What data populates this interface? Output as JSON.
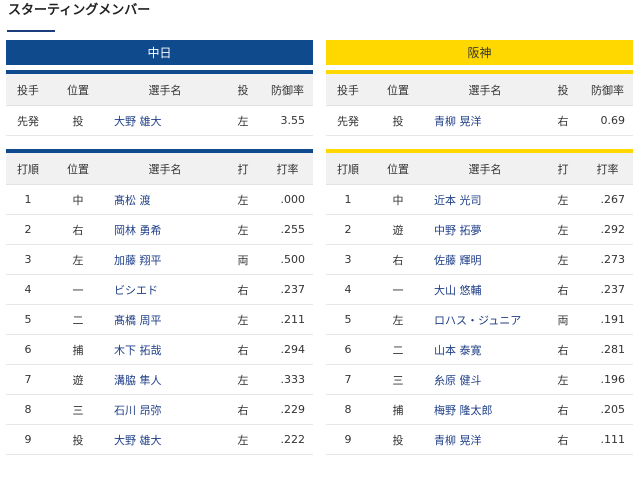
{
  "page_title": "スターティングメンバー",
  "colors": {
    "home_accent": "#0f4a8c",
    "away_accent": "#ffd800",
    "name_link": "#1f3f88",
    "header_bg": "#f1f1f1"
  },
  "teams": [
    {
      "name": "中日",
      "pitcher_headers": [
        "投手",
        "位置",
        "選手名",
        "投",
        "防御率"
      ],
      "pitcher": [
        "先発",
        "投",
        "大野 雄大",
        "左",
        "3.55"
      ],
      "batting_headers": [
        "打順",
        "位置",
        "選手名",
        "打",
        "打率"
      ],
      "batters": [
        [
          "1",
          "中",
          "髙松 渡",
          "左",
          ".000"
        ],
        [
          "2",
          "右",
          "岡林 勇希",
          "左",
          ".255"
        ],
        [
          "3",
          "左",
          "加藤 翔平",
          "両",
          ".500"
        ],
        [
          "4",
          "一",
          "ビシエド",
          "右",
          ".237"
        ],
        [
          "5",
          "二",
          "髙橋 周平",
          "左",
          ".211"
        ],
        [
          "6",
          "捕",
          "木下 拓哉",
          "右",
          ".294"
        ],
        [
          "7",
          "遊",
          "溝脇 隼人",
          "左",
          ".333"
        ],
        [
          "8",
          "三",
          "石川 昂弥",
          "右",
          ".229"
        ],
        [
          "9",
          "投",
          "大野 雄大",
          "左",
          ".222"
        ]
      ]
    },
    {
      "name": "阪神",
      "pitcher_headers": [
        "投手",
        "位置",
        "選手名",
        "投",
        "防御率"
      ],
      "pitcher": [
        "先発",
        "投",
        "青柳 晃洋",
        "右",
        "0.69"
      ],
      "batting_headers": [
        "打順",
        "位置",
        "選手名",
        "打",
        "打率"
      ],
      "batters": [
        [
          "1",
          "中",
          "近本 光司",
          "左",
          ".267"
        ],
        [
          "2",
          "遊",
          "中野 拓夢",
          "左",
          ".292"
        ],
        [
          "3",
          "右",
          "佐藤 輝明",
          "左",
          ".273"
        ],
        [
          "4",
          "一",
          "大山 悠輔",
          "右",
          ".237"
        ],
        [
          "5",
          "左",
          "ロハス・ジュニア",
          "両",
          ".191"
        ],
        [
          "6",
          "二",
          "山本 泰寛",
          "右",
          ".281"
        ],
        [
          "7",
          "三",
          "糸原 健斗",
          "左",
          ".196"
        ],
        [
          "8",
          "捕",
          "梅野 隆太郎",
          "右",
          ".205"
        ],
        [
          "9",
          "投",
          "青柳 晃洋",
          "右",
          ".111"
        ]
      ]
    }
  ]
}
